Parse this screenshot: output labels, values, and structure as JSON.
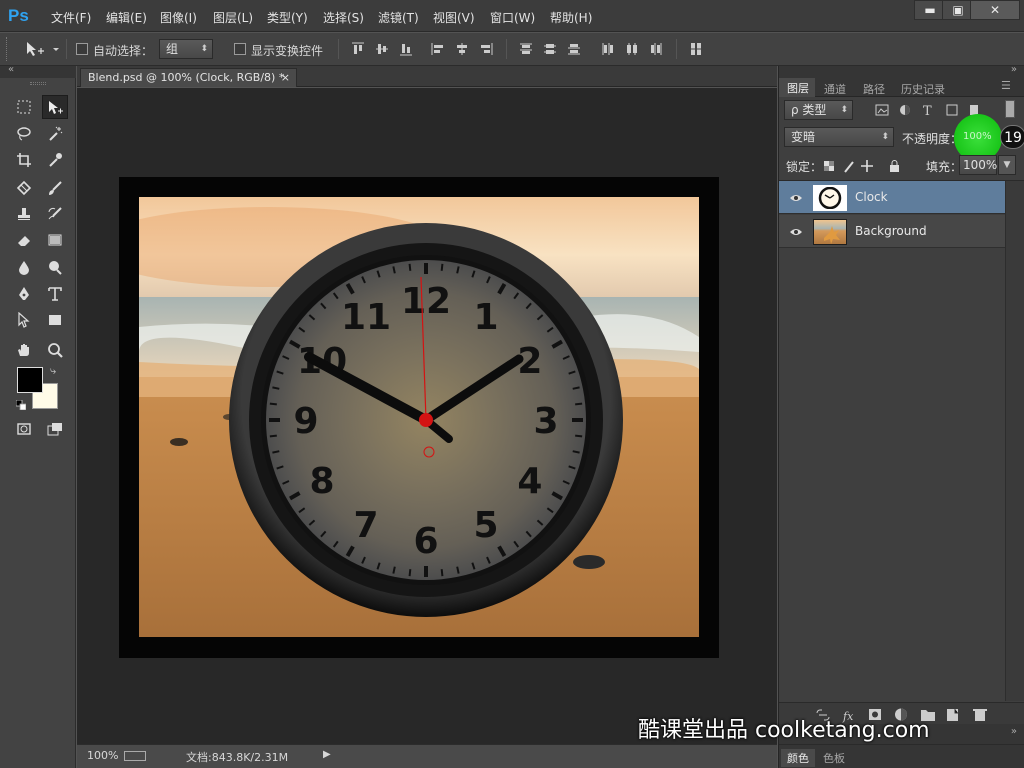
{
  "app": {
    "logo": "Ps"
  },
  "menu": [
    "文件(F)",
    "编辑(E)",
    "图像(I)",
    "图层(L)",
    "类型(Y)",
    "选择(S)",
    "滤镜(T)",
    "视图(V)",
    "窗口(W)",
    "帮助(H)"
  ],
  "window_controls": {
    "minimize": "▬",
    "maximize": "▣",
    "close": "✕"
  },
  "options": {
    "auto_select_label": "自动选择：",
    "auto_select_value": "组",
    "show_transform_label": "显示变换控件"
  },
  "document": {
    "tab_title": "Blend.psd @ 100% (Clock, RGB/8) *",
    "tab_close": "×",
    "clock_numbers": [
      "12",
      "1",
      "2",
      "3",
      "4",
      "5",
      "6",
      "7",
      "8",
      "9",
      "10",
      "11"
    ]
  },
  "status": {
    "zoom": "100%",
    "doc_info": "文档:843.8K/2.31M"
  },
  "panel": {
    "tabs": [
      "图层",
      "通道",
      "路径",
      "历史记录"
    ],
    "filter_label": "ρ 类型",
    "blend_mode": "变暗",
    "opacity_label": "不透明度：",
    "opacity_value": "100%",
    "step_badge": "19",
    "lock_label": "锁定：",
    "fill_label": "填充：",
    "fill_value": "100%",
    "layers": [
      {
        "name": "Clock",
        "selected": true
      },
      {
        "name": "Background",
        "selected": false
      }
    ],
    "bottom_tabs": [
      "颜色",
      "色板"
    ]
  },
  "watermark": "酷课堂出品 coolketang.com",
  "colors": {
    "accent": "#2fa3f1",
    "selected_layer": "#5f7d9c",
    "highlight": "#1fcc1f"
  }
}
